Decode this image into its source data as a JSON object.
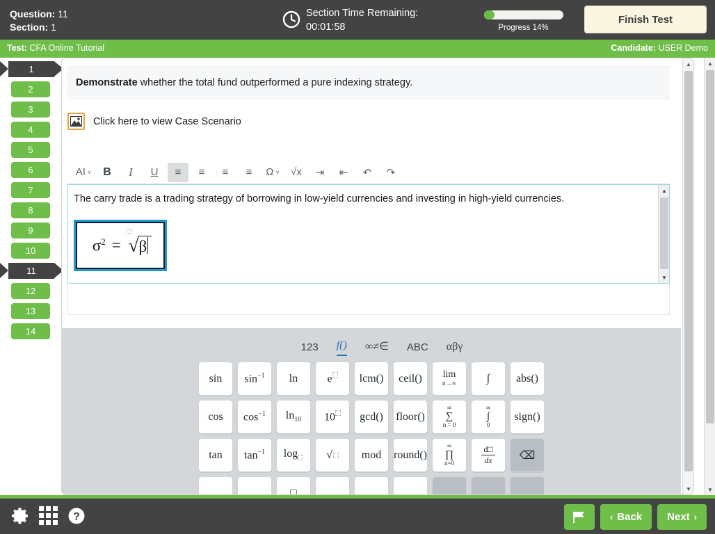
{
  "header": {
    "question_label": "Question:",
    "question_value": "11",
    "section_label": "Section:",
    "section_value": "1",
    "clock_icon": "clock-icon",
    "timer_label": "Section Time Remaining:",
    "timer_value": "00:01:58",
    "progress_label": "Progress 14%",
    "progress_percent": 14,
    "finish_test_label": "Finish Test",
    "bar_bg": "#434343",
    "finish_bg": "#fbf6e1"
  },
  "subbar": {
    "test_label": "Test:",
    "test_value": "CFA Online Tutorial",
    "candidate_label": "Candidate:",
    "candidate_value": "USER Demo",
    "bg": "#6fbe4a"
  },
  "qnav": {
    "items": [
      {
        "number": "1",
        "state": "visited"
      },
      {
        "number": "2",
        "state": "answered"
      },
      {
        "number": "3",
        "state": "answered"
      },
      {
        "number": "4",
        "state": "answered"
      },
      {
        "number": "5",
        "state": "answered"
      },
      {
        "number": "6",
        "state": "answered"
      },
      {
        "number": "7",
        "state": "answered"
      },
      {
        "number": "8",
        "state": "answered"
      },
      {
        "number": "9",
        "state": "answered"
      },
      {
        "number": "10",
        "state": "answered"
      },
      {
        "number": "11",
        "state": "current"
      },
      {
        "number": "12",
        "state": "answered"
      },
      {
        "number": "13",
        "state": "answered"
      },
      {
        "number": "14",
        "state": "answered"
      }
    ],
    "answered_color": "#6fbe4a",
    "current_color": "#434343"
  },
  "question": {
    "stem_bold": "Demonstrate",
    "stem_rest": " whether the total fund outperformed a pure indexing strategy.",
    "case_icon": "image-icon",
    "case_link_text": "Click here to view Case Scenario"
  },
  "toolbar": {
    "buttons": [
      {
        "name": "font-size-dropdown",
        "glyph": "AI",
        "chevron": "˅"
      },
      {
        "name": "bold-button",
        "glyph": "B"
      },
      {
        "name": "italic-button",
        "glyph": "I"
      },
      {
        "name": "underline-button",
        "glyph": "U"
      },
      {
        "name": "align-left-button",
        "glyph": "≡",
        "active": true
      },
      {
        "name": "align-center-button",
        "glyph": "≡"
      },
      {
        "name": "align-right-button",
        "glyph": "≡"
      },
      {
        "name": "justify-button",
        "glyph": "≡"
      },
      {
        "name": "special-character-button",
        "glyph": "Ω",
        "chevron": "˅"
      },
      {
        "name": "math-equation-button",
        "glyph": "√x"
      },
      {
        "name": "indent-button",
        "glyph": "⇥"
      },
      {
        "name": "outdent-button",
        "glyph": "⇤"
      },
      {
        "name": "undo-button",
        "glyph": "↶"
      },
      {
        "name": "redo-button",
        "glyph": "↷"
      }
    ]
  },
  "editor": {
    "answer_text": "The carry trade is a trading strategy of borrowing in low-yield currencies and investing in high-yield currencies.",
    "formula": {
      "lhs_symbol": "σ",
      "lhs_exponent": "2",
      "operator": "=",
      "radical_symbol": "√",
      "radicand": "β",
      "selected": true,
      "border_color": "#2196c9"
    }
  },
  "math_keyboard": {
    "tabs": [
      {
        "label": "123",
        "active": false
      },
      {
        "label": "f()",
        "active": true
      },
      {
        "label": "∞≠∈",
        "active": false
      },
      {
        "label": "ABC",
        "active": false
      },
      {
        "label": "αβγ",
        "active": false
      }
    ],
    "rows": [
      [
        {
          "name": "sin",
          "main": "sin"
        },
        {
          "name": "arcsin",
          "main": "sin",
          "sup": "−1"
        },
        {
          "name": "ln",
          "main": "ln"
        },
        {
          "name": "e-power",
          "main": "e",
          "supbox": true
        },
        {
          "name": "lcm",
          "main": "lcm()"
        },
        {
          "name": "ceil",
          "main": "ceil()"
        },
        {
          "name": "limit",
          "stack": {
            "top": "lim",
            "bot": "n→∞"
          }
        },
        {
          "name": "integral",
          "main": "∫"
        },
        {
          "name": "abs",
          "main": "abs()"
        }
      ],
      [
        {
          "name": "cos",
          "main": "cos"
        },
        {
          "name": "arccos",
          "main": "cos",
          "sup": "−1"
        },
        {
          "name": "log-base-10",
          "main": "ln",
          "sub": "10"
        },
        {
          "name": "ten-power",
          "main": "10",
          "supbox": true
        },
        {
          "name": "gcd",
          "main": "gcd()"
        },
        {
          "name": "floor",
          "main": "floor()"
        },
        {
          "name": "summation",
          "stack": {
            "top": "∞",
            "mid": "∑",
            "bot": "n = 0"
          }
        },
        {
          "name": "definite-integral",
          "stack": {
            "top": "∞",
            "mid": "∫",
            "bot": "0"
          }
        },
        {
          "name": "sign",
          "main": "sign()"
        }
      ],
      [
        {
          "name": "tan",
          "main": "tan"
        },
        {
          "name": "arctan",
          "main": "tan",
          "sup": "−1"
        },
        {
          "name": "log-base",
          "main": "log",
          "subbox": true
        },
        {
          "name": "nth-root",
          "main": "√",
          "rootbox": true
        },
        {
          "name": "mod",
          "main": "mod"
        },
        {
          "name": "round",
          "main": "round()"
        },
        {
          "name": "product",
          "stack": {
            "mid": "∏",
            "top": "∞",
            "bot": "n=0"
          }
        },
        {
          "name": "derivative",
          "frac": {
            "num": "d□",
            "den": "dx"
          }
        },
        {
          "name": "backspace",
          "main": "⌫",
          "grey": true
        }
      ],
      [
        {
          "name": "key-r4c1",
          "main": ""
        },
        {
          "name": "key-r4c2",
          "main": ""
        },
        {
          "name": "key-r4c3",
          "main": "□"
        },
        {
          "name": "key-r4c4",
          "main": ""
        },
        {
          "name": "key-r4c5",
          "main": ""
        },
        {
          "name": "key-r4c6",
          "main": ""
        },
        {
          "name": "key-r4c7",
          "main": "",
          "grey": true
        },
        {
          "name": "key-r4c8",
          "main": "",
          "grey": true
        },
        {
          "name": "key-r4c9",
          "main": "",
          "grey": true
        }
      ]
    ]
  },
  "bottom": {
    "settings_icon": "gear-icon",
    "grid_icon": "grid-icon",
    "help_icon": "help-icon",
    "flag_icon": "flag-icon",
    "back_label": "Back",
    "back_caret": "‹",
    "next_label": "Next",
    "next_caret": "›",
    "button_color": "#6fbe4a",
    "bar_color": "#434343"
  },
  "scrollbars": {
    "up_arrow": "▲",
    "down_arrow": "▼"
  }
}
